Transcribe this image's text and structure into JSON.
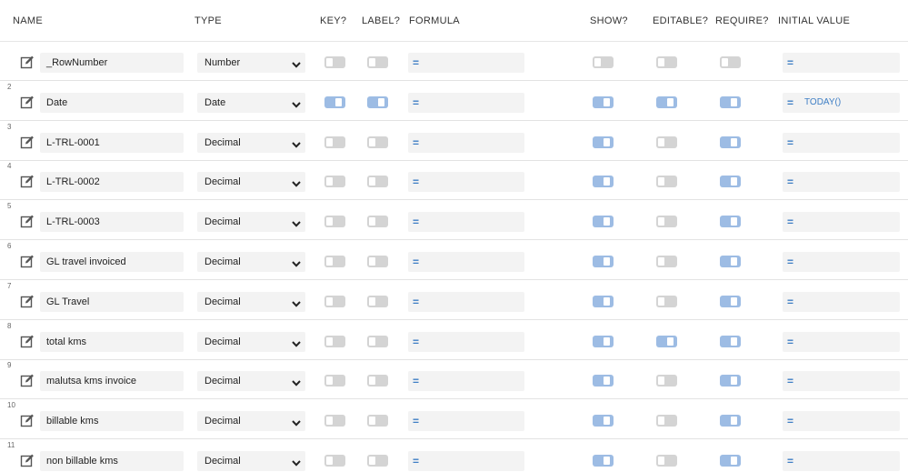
{
  "headers": {
    "name": "NAME",
    "type": "TYPE",
    "key": "KEY?",
    "label": "LABEL?",
    "formula": "FORMULA",
    "show": "SHOW?",
    "editable": "EDITABLE?",
    "require": "REQUIRE?",
    "initial_value": "INITIAL VALUE"
  },
  "formula_symbol": "=",
  "colors": {
    "toggle_on": "#9dbce4",
    "toggle_off": "#d4d4d4",
    "formula_accent": "#3f7fc5",
    "field_bg": "#f3f3f3"
  },
  "rows": [
    {
      "num": "",
      "name": "_RowNumber",
      "type": "Number",
      "key": false,
      "label": false,
      "formula": "",
      "show": false,
      "editable": false,
      "require": false,
      "initial": ""
    },
    {
      "num": "2",
      "name": "Date",
      "type": "Date",
      "key": true,
      "label": true,
      "formula": "",
      "show": true,
      "editable": true,
      "require": true,
      "initial": "TODAY()"
    },
    {
      "num": "3",
      "name": "L-TRL-0001",
      "type": "Decimal",
      "key": false,
      "label": false,
      "formula": "",
      "show": true,
      "editable": false,
      "require": true,
      "initial": ""
    },
    {
      "num": "4",
      "name": "L-TRL-0002",
      "type": "Decimal",
      "key": false,
      "label": false,
      "formula": "",
      "show": true,
      "editable": false,
      "require": true,
      "initial": ""
    },
    {
      "num": "5",
      "name": "L-TRL-0003",
      "type": "Decimal",
      "key": false,
      "label": false,
      "formula": "",
      "show": true,
      "editable": false,
      "require": true,
      "initial": ""
    },
    {
      "num": "6",
      "name": "GL travel invoiced",
      "type": "Decimal",
      "key": false,
      "label": false,
      "formula": "",
      "show": true,
      "editable": false,
      "require": true,
      "initial": ""
    },
    {
      "num": "7",
      "name": "GL Travel",
      "type": "Decimal",
      "key": false,
      "label": false,
      "formula": "",
      "show": true,
      "editable": false,
      "require": true,
      "initial": ""
    },
    {
      "num": "8",
      "name": "total kms",
      "type": "Decimal",
      "key": false,
      "label": false,
      "formula": "",
      "show": true,
      "editable": true,
      "require": true,
      "initial": ""
    },
    {
      "num": "9",
      "name": "malutsa kms invoice",
      "type": "Decimal",
      "key": false,
      "label": false,
      "formula": "",
      "show": true,
      "editable": false,
      "require": true,
      "initial": ""
    },
    {
      "num": "10",
      "name": "billable kms",
      "type": "Decimal",
      "key": false,
      "label": false,
      "formula": "",
      "show": true,
      "editable": false,
      "require": true,
      "initial": ""
    },
    {
      "num": "11",
      "name": "non billable kms",
      "type": "Decimal",
      "key": false,
      "label": false,
      "formula": "",
      "show": true,
      "editable": false,
      "require": true,
      "initial": ""
    }
  ]
}
